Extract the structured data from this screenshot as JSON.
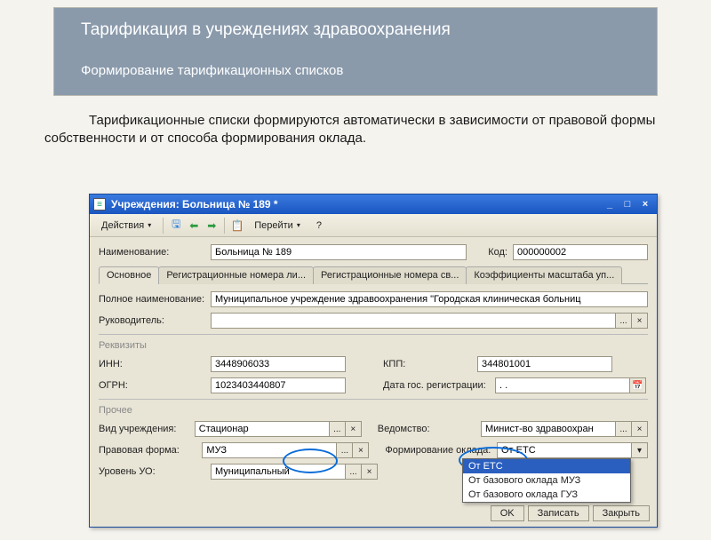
{
  "banner": {
    "title": "Тарификация в учреждениях здравоохранения",
    "subtitle": "Формирование тарификационных списков"
  },
  "intro": "Тарификационные списки формируются автоматически в зависимости от правовой формы собственности и от способа формирования оклада.",
  "window": {
    "title": "Учреждения: Больница № 189 *",
    "toolbar": {
      "actions": "Действия",
      "goto": "Перейти",
      "help": "?"
    },
    "form": {
      "name_label": "Наименование:",
      "name_value": "Больница № 189",
      "kod_label": "Код:",
      "kod_value": "000000002",
      "tabs": [
        "Основное",
        "Регистрационные номера ли...",
        "Регистрационные номера св...",
        "Коэффициенты масштаба уп..."
      ],
      "fullname_label": "Полное наименование:",
      "fullname_value": "Муниципальное учреждение здравоохранения \"Городская клиническая больниц",
      "head_label": "Руководитель:",
      "head_value": "",
      "rekvizity": "Реквизиты",
      "inn_label": "ИНН:",
      "inn_value": "3448906033",
      "kpp_label": "КПП:",
      "kpp_value": "344801001",
      "ogrn_label": "ОГРН:",
      "ogrn_value": "1023403440807",
      "regdate_label": "Дата гос. регистрации:",
      "regdate_value": ". .",
      "prochee": "Прочее",
      "vid_label": "Вид учреждения:",
      "vid_value": "Стационар",
      "vedom_label": "Ведомство:",
      "vedom_value": "Минист-во здравоохран",
      "pform_label": "Правовая форма:",
      "pform_value": "МУЗ",
      "oklad_label": "Формирование оклада:",
      "oklad_value": "От ЕТС",
      "uroven_label": "Уровень УО:",
      "uroven_value": "Муниципальный"
    },
    "dropdown": {
      "options": [
        "От ЕТС",
        "От базового оклада МУЗ",
        "От базового оклада ГУЗ"
      ],
      "selected_index": 0
    },
    "buttons": {
      "ok": "OK",
      "save": "Записать",
      "close": "Закрыть"
    }
  }
}
